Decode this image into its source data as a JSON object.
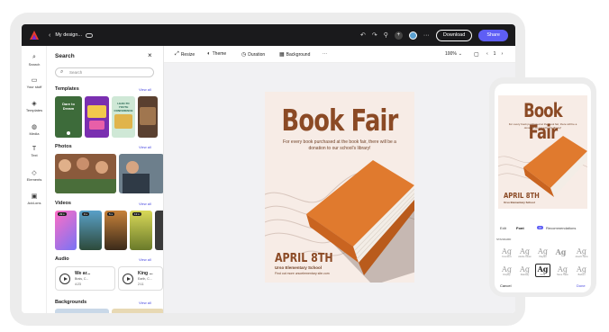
{
  "topbar": {
    "title": "My design...",
    "download_label": "Download",
    "share_label": "Share",
    "share_color": "#5e5ef5"
  },
  "rail": {
    "items": [
      {
        "label": "Search",
        "icon": "search-icon"
      },
      {
        "label": "Your stuff",
        "icon": "folder-icon"
      },
      {
        "label": "Templates",
        "icon": "templates-icon"
      },
      {
        "label": "Media",
        "icon": "media-icon"
      },
      {
        "label": "Text",
        "icon": "text-icon"
      },
      {
        "label": "Elements",
        "icon": "elements-icon"
      },
      {
        "label": "Add-ons",
        "icon": "addons-icon"
      }
    ]
  },
  "panel": {
    "title": "Search",
    "search_placeholder": "Search",
    "view_all": "View all",
    "sections": {
      "templates": "Templates",
      "photos": "Photos",
      "videos": "Videos",
      "audio": "Audio",
      "backgrounds": "Backgrounds"
    },
    "template_texts": [
      "Dare to Dream",
      "",
      "LEAD-TO YOUTH CONFERENCE",
      ""
    ],
    "video_durations": [
      "29 s",
      "9 s",
      "5 s",
      "13 s",
      ""
    ],
    "audio": [
      {
        "name": "We ar...",
        "artist": "Brais, C...",
        "duration": "4:23"
      },
      {
        "name": "King ...",
        "artist": "Earth, C...",
        "duration": "2:11"
      }
    ]
  },
  "toolbar": {
    "items": [
      "Resize",
      "Theme",
      "Duration",
      "Background"
    ],
    "more": "···",
    "zoom": "100%",
    "page": "1"
  },
  "poster": {
    "title": "Book Fair",
    "description": "For every book purchased at the book fair, there will be a donation to our school's library!",
    "date": "APRIL 8TH",
    "school": "Urso Elementary School",
    "site": "Find out more ursoelementary site.com",
    "bg_color": "#f7ece6",
    "accent_color": "#8b4a25",
    "book_color": "#e07a2e"
  },
  "phone": {
    "title": "Book Fair",
    "description": "For every book purchased at the book fair, there will be a donation to our school's library!",
    "date": "APRIL 8TH",
    "school": "Urso Elementary School",
    "tabs": [
      "Edit",
      "Font",
      "Recommendations"
    ],
    "ai_badge": "AI",
    "standard_label": "STANDARD",
    "font_sample": "Ag",
    "font_names": [
      "Founders",
      "Adobe Clean",
      "Playfair",
      "",
      "Josefin Sans",
      "Source Serif",
      "Display",
      "Raleway",
      "Lora",
      "Neue Haas",
      "Bodoni",
      "Minion"
    ],
    "cancel": "Cancel",
    "done": "Done"
  }
}
